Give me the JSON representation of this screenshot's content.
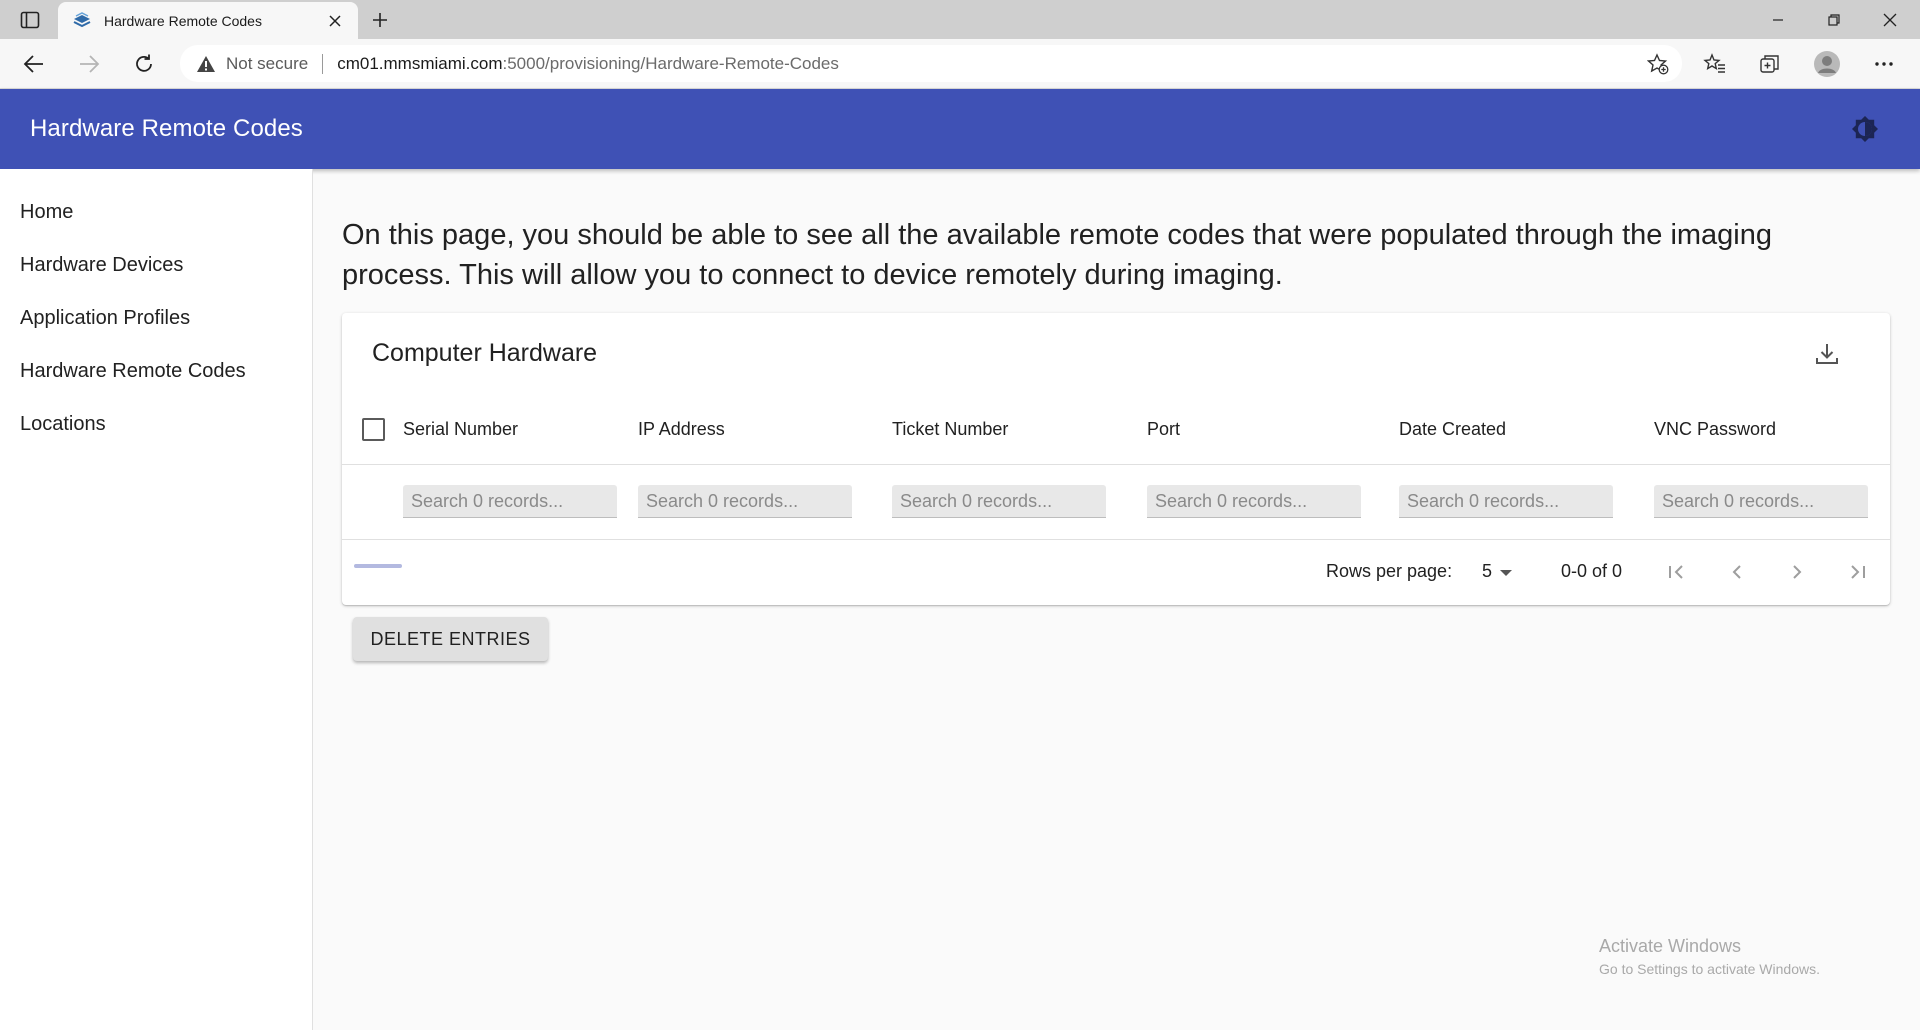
{
  "browser": {
    "tab_title": "Hardware Remote Codes",
    "security_label": "Not secure",
    "url_host": "cm01.mmsmiami.com",
    "url_rest": ":5000/provisioning/Hardware-Remote-Codes"
  },
  "app": {
    "title": "Hardware Remote Codes",
    "brand_color": "#3f51b5"
  },
  "sidebar": {
    "items": [
      {
        "label": "Home"
      },
      {
        "label": "Hardware Devices"
      },
      {
        "label": "Application Profiles"
      },
      {
        "label": "Hardware Remote Codes"
      },
      {
        "label": "Locations"
      }
    ]
  },
  "intro_text": "On this page, you should be able to see all the available remote codes that were populated through the imaging process. This will allow you to connect to device remotely during imaging.",
  "table": {
    "title": "Computer Hardware",
    "columns": [
      {
        "label": "Serial Number",
        "placeholder": "Search 0 records..."
      },
      {
        "label": "IP Address",
        "placeholder": "Search 0 records..."
      },
      {
        "label": "Ticket Number",
        "placeholder": "Search 0 records..."
      },
      {
        "label": "Port",
        "placeholder": "Search 0 records..."
      },
      {
        "label": "Date Created",
        "placeholder": "Search 0 records..."
      },
      {
        "label": "VNC Password",
        "placeholder": "Search 0 records..."
      }
    ],
    "pagination": {
      "rows_label": "Rows per page:",
      "rows_value": "5",
      "range": "0-0 of 0"
    }
  },
  "delete_button": "DELETE ENTRIES",
  "watermark": {
    "title": "Activate Windows",
    "subtitle": "Go to Settings to activate Windows."
  }
}
